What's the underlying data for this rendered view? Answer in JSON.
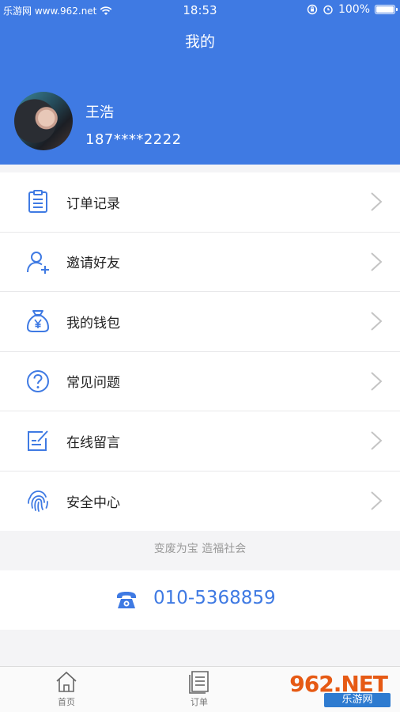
{
  "status_bar": {
    "carrier": "乐游网 www.962.net",
    "time": "18:53",
    "battery": "100%"
  },
  "header": {
    "title": "我的",
    "user": {
      "name": "王浩",
      "phone": "187****2222"
    }
  },
  "menu": {
    "items": [
      {
        "label": "订单记录",
        "icon": "order-list-icon"
      },
      {
        "label": "邀请好友",
        "icon": "add-user-icon"
      },
      {
        "label": "我的钱包",
        "icon": "money-bag-icon"
      },
      {
        "label": "常见问题",
        "icon": "question-icon"
      },
      {
        "label": "在线留言",
        "icon": "edit-note-icon"
      },
      {
        "label": "安全中心",
        "icon": "fingerprint-icon"
      }
    ]
  },
  "footer": {
    "slogan": "变废为宝 造福社会",
    "hotline": "010-5368859"
  },
  "tabbar": {
    "tabs": [
      {
        "label": "首页",
        "icon": "home-icon"
      },
      {
        "label": "订单",
        "icon": "order-icon"
      }
    ]
  },
  "watermark": {
    "brand": "962.NET",
    "sub": "乐游网"
  },
  "colors": {
    "primary": "#3f7ae3",
    "icon": "#3f7ae3",
    "background": "#f4f4f6"
  }
}
